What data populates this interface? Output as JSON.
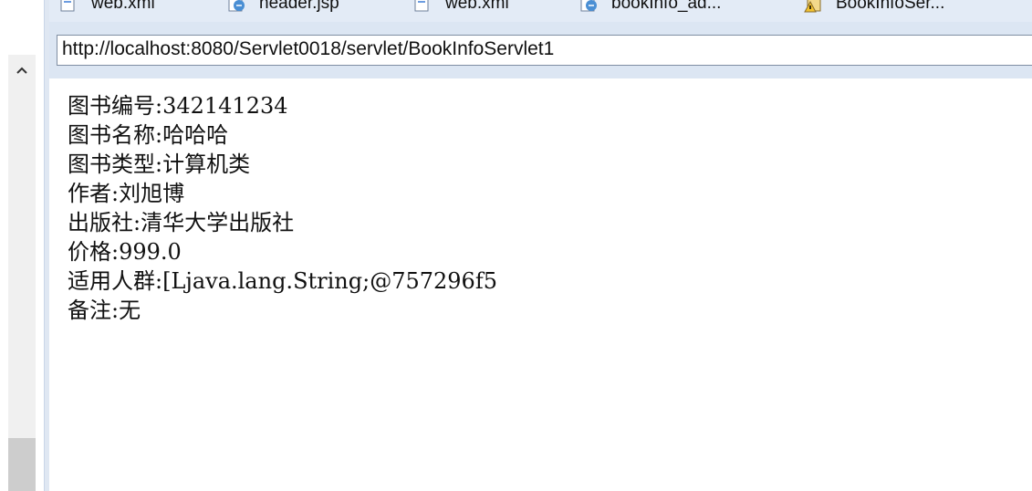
{
  "tabs": [
    {
      "label": "web.xml",
      "icon": "xml-file-icon"
    },
    {
      "label": "header.jsp",
      "icon": "jsp-file-icon"
    },
    {
      "label": "web.xml",
      "icon": "xml-file-icon"
    },
    {
      "label": "bookInfo_ad...",
      "icon": "jsp-file-icon"
    },
    {
      "label": "BookInfoSer...",
      "icon": "java-warning-file-icon"
    }
  ],
  "browser": {
    "url": "http://localhost:8080/Servlet0018/servlet/BookInfoServlet1"
  },
  "book": {
    "lines": [
      "图书编号:342141234",
      "图书名称:哈哈哈",
      "图书类型:计算机类",
      "作者:刘旭博",
      "出版社:清华大学出版社",
      "价格:999.0",
      "适用人群:[Ljava.lang.String;@757296f5",
      "备注:无"
    ]
  },
  "scrollbar": {
    "up_arrow": "^"
  }
}
